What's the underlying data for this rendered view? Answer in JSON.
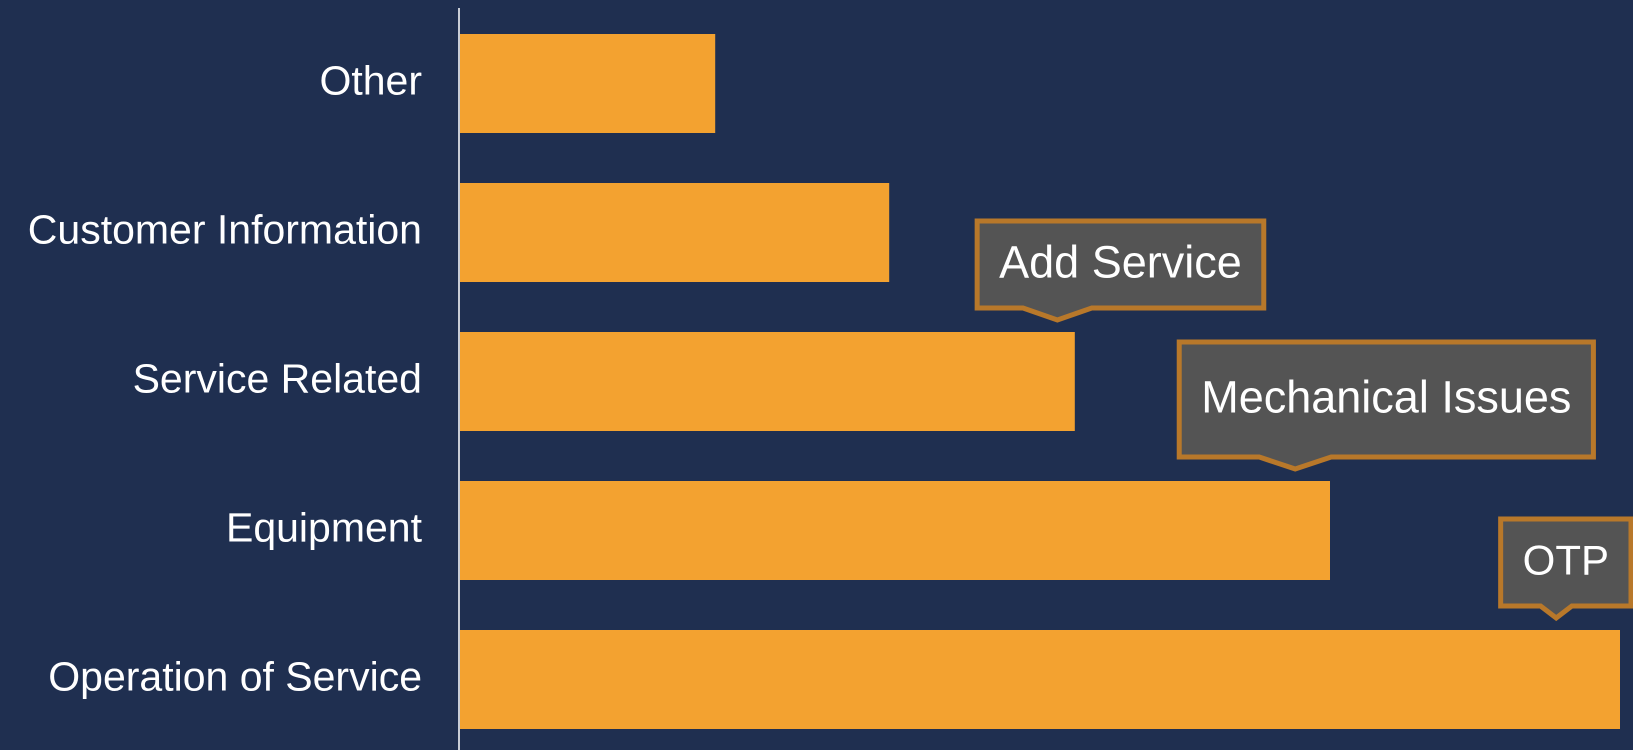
{
  "colors": {
    "background": "#1f2f50",
    "bar": "#f3a230",
    "axis_line": "#c9cdd6",
    "label_text": "#ffffff",
    "callout_fill": "#545454",
    "callout_border": "#b8782a",
    "callout_text": "#ffffff"
  },
  "chart_data": {
    "type": "bar",
    "orientation": "horizontal",
    "categories": [
      "Other",
      "Customer Information",
      "Service Related",
      "Equipment",
      "Operation of Service"
    ],
    "values": [
      22,
      37,
      53,
      75,
      100
    ],
    "xlim": [
      0,
      100
    ],
    "title": "",
    "xlabel": "",
    "ylabel": "",
    "grid": false,
    "legend": "none",
    "annotations": [
      {
        "text": "Add Service",
        "category": "Service Related",
        "value": 51.5
      },
      {
        "text": "Mechanical Issues",
        "category": "Equipment",
        "value": 72
      },
      {
        "text": "OTP",
        "category": "Operation of Service",
        "value": 94.5
      }
    ]
  }
}
